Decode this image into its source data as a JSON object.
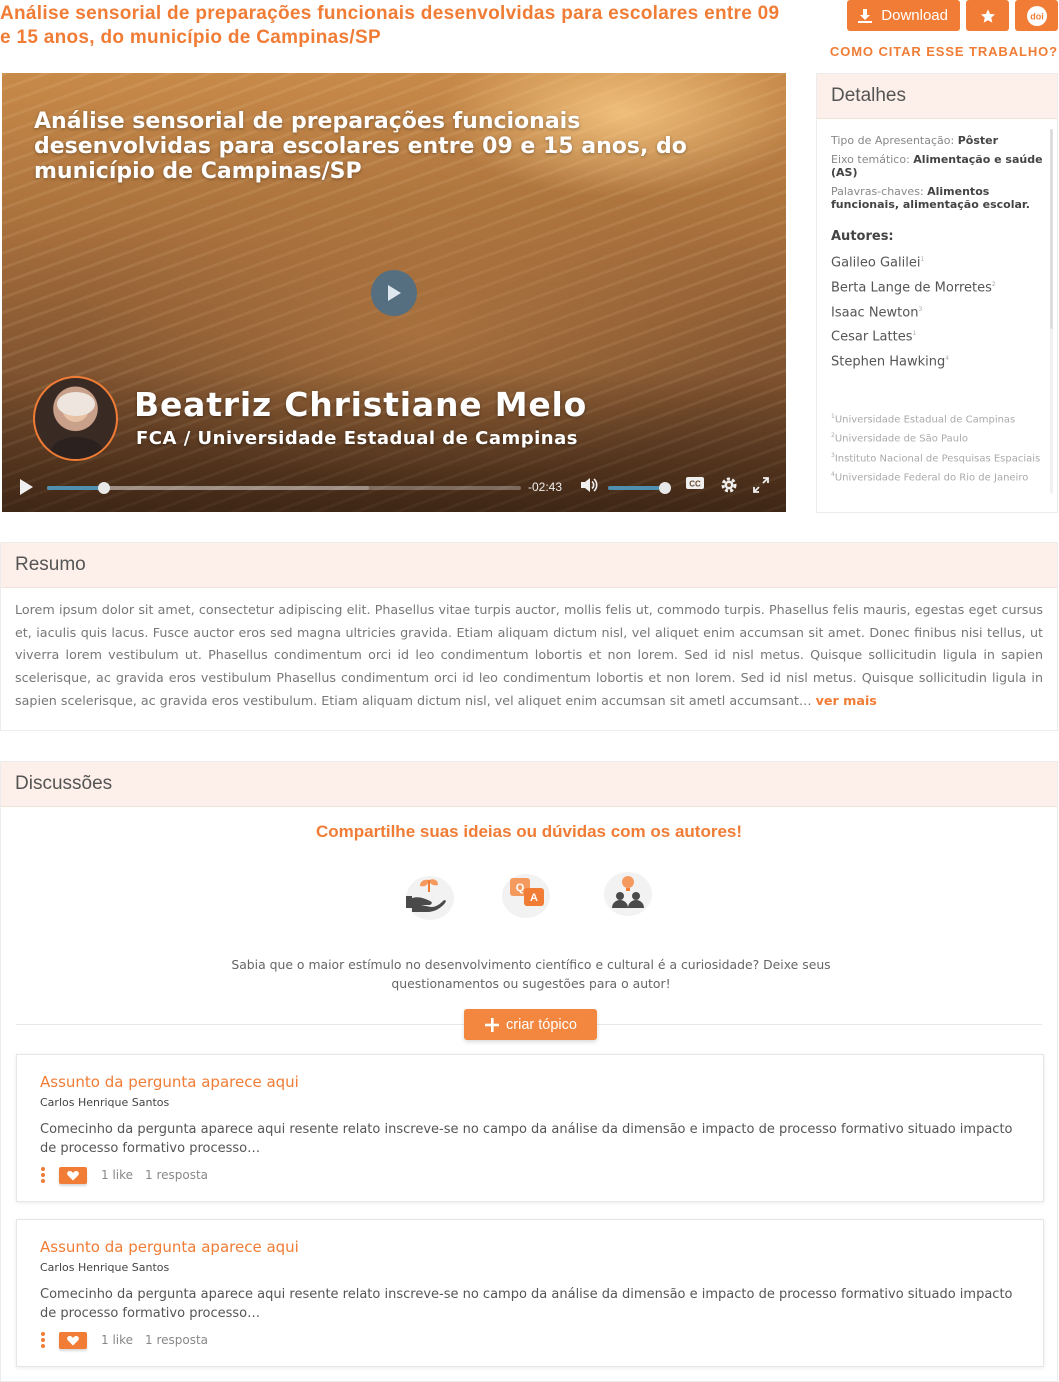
{
  "header": {
    "title": "Análise sensorial de preparações funcionais desenvolvidas para escolares entre 09 e 15 anos, do município de Campinas/SP",
    "download_label": "Download",
    "favorite_icon": "star-icon",
    "doi_label": "doi",
    "cite_label": "COMO CITAR ESSE TRABALHO?"
  },
  "video": {
    "title": "Análise sensorial de preparações funcionais desenvolvidas para escolares entre 09 e 15 anos, do município de Campinas/SP",
    "presenter_name": "Beatriz Christiane Melo",
    "presenter_affiliation": "FCA / Universidade Estadual de Campinas",
    "time_remaining": "-02:43",
    "progress": 0.12,
    "buffered": 0.68,
    "volume": 0.95,
    "accent": "#4f8fb0"
  },
  "details": {
    "heading": "Detalhes",
    "presentation_type_label": "Tipo de Apresentação:",
    "presentation_type_value": "Pôster",
    "axis_label": "Eixo temático:",
    "axis_value": "Alimentação e saúde (AS)",
    "keywords_label": "Palavras-chaves:",
    "keywords_value": "Alimentos funcionais, alimentação escolar.",
    "authors_heading": "Autores:",
    "authors": [
      {
        "name": "Galileo Galilei",
        "ref": "1"
      },
      {
        "name": "Berta Lange de Morretes",
        "ref": "2"
      },
      {
        "name": "Isaac Newton",
        "ref": "3"
      },
      {
        "name": "Cesar Lattes",
        "ref": "1"
      },
      {
        "name": "Stephen Hawking",
        "ref": "4"
      }
    ],
    "institutions": [
      {
        "ref": "1",
        "name": "Universidade Estadual de Campinas"
      },
      {
        "ref": "2",
        "name": "Universidade de São Paulo"
      },
      {
        "ref": "3",
        "name": "Instituto Nacional de Pesquisas Espaciais"
      },
      {
        "ref": "4",
        "name": "Universidade Federal do Rio de Janeiro"
      }
    ]
  },
  "resumo": {
    "heading": "Resumo",
    "text": "Lorem ipsum dolor sit amet, consectetur adipiscing elit. Phasellus vitae turpis auctor, mollis felis ut, commodo turpis. Phasellus felis mauris, egestas eget cursus et, iaculis quis lacus. Fusce auctor eros sed magna ultricies gravida. Etiam aliquam dictum nisl, vel aliquet enim accumsan sit amet. Donec finibus nisi tellus, ut viverra lorem vestibulum ut.  Phasellus condimentum orci id leo condimentum lobortis et non lorem. Sed id nisl metus. Quisque sollicitudin ligula in sapien scelerisque, ac gravida eros vestibulum Phasellus condimentum orci id leo condimentum lobortis et non lorem. Sed id nisl metus. Quisque sollicitudin ligula in sapien scelerisque, ac gravida eros vestibulum.  Etiam aliquam dictum nisl, vel aliquet enim accumsan sit ametl accumsant…",
    "see_more": "ver mais"
  },
  "discussions": {
    "heading": "Discussões",
    "cta": "Compartilhe suas ideias ou dúvidas com os autores!",
    "icons": [
      "growing-plant-hand-icon",
      "question-answer-icon",
      "people-idea-icon"
    ],
    "description": "Sabia que o maior estímulo no desenvolvimento científico e cultural é a curiosidade? Deixe seus questionamentos ou sugestões para o autor!",
    "create_label": "criar tópico",
    "topics": [
      {
        "title": "Assunto da pergunta aparece aqui",
        "author": "Carlos Henrique Santos",
        "body": "Comecinho da pergunta aparece aqui resente relato inscreve-se no campo da análise da dimensão e impacto de processo formativo situado impacto de processo formativo processo…",
        "likes": "1 like",
        "replies": "1 resposta"
      },
      {
        "title": "Assunto da pergunta aparece aqui",
        "author": "Carlos Henrique Santos",
        "body": "Comecinho da pergunta aparece aqui resente relato inscreve-se no campo da análise da dimensão e impacto de processo formativo situado impacto de processo formativo processo…",
        "likes": "1 like",
        "replies": "1 resposta"
      }
    ]
  },
  "colors": {
    "brand": "#f07c35",
    "panel_header": "#fdf0ea"
  }
}
